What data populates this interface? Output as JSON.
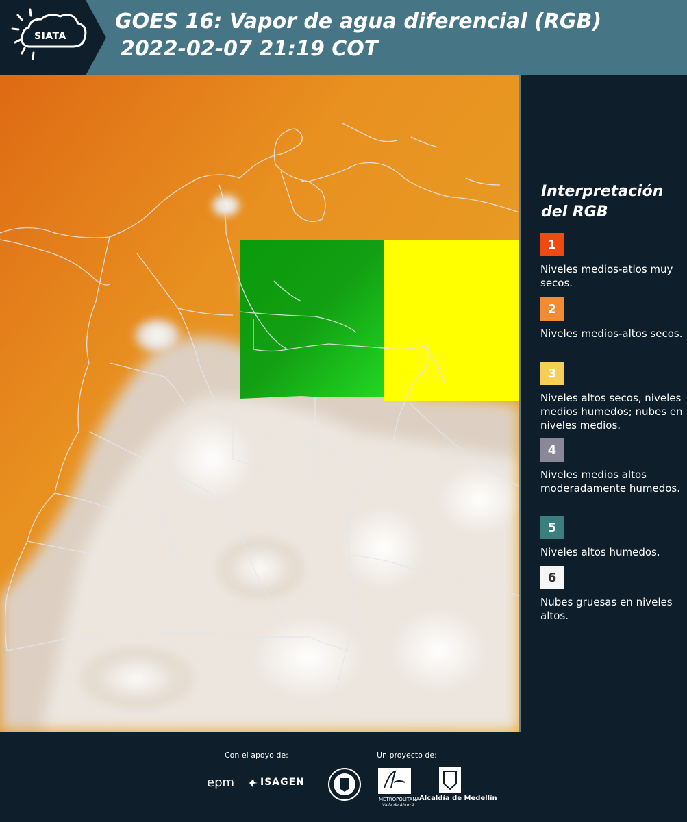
{
  "header": {
    "logo_text": "SIATA",
    "title_line1": "GOES 16: Vapor de agua diferencial (RGB)",
    "title_line2": "2022-02-07 21:19 COT"
  },
  "legend": {
    "title": "Interpretación del RGB",
    "items": [
      {
        "number": "1",
        "color": "#f04a12",
        "text": "Niveles medios-atlos muy secos."
      },
      {
        "number": "2",
        "color": "#f18b34",
        "text": "Niveles medios-altos secos."
      },
      {
        "number": "3",
        "color": "#f7cf56",
        "text": "Niveles altos secos, niveles medios humedos; nubes en niveles medios."
      },
      {
        "number": "4",
        "color": "#8a8898",
        "text": "Niveles medios altos moderadamente humedos."
      },
      {
        "number": "5",
        "color": "#3a7e7d",
        "text": "Niveles altos humedos."
      },
      {
        "number": "6",
        "color": "#f6f6f6",
        "text": "Nubes gruesas en niveles altos."
      }
    ]
  },
  "map": {
    "colors": {
      "orange": "#e8a020",
      "dark_orange": "#e07018",
      "green": "#13a513",
      "yellow": "#ffff00",
      "cloud": "#e9e4df",
      "border": "#d9dde2"
    }
  },
  "footer": {
    "support_caption": "Con el apoyo de:",
    "project_caption": "Un proyecto de:",
    "sponsors": [
      "epm",
      "ISAGEN"
    ],
    "partners": [
      "METROPOLITANA",
      "Alcaldía de Medellín"
    ],
    "partner_subtitle": "Valle de Aburrá"
  }
}
